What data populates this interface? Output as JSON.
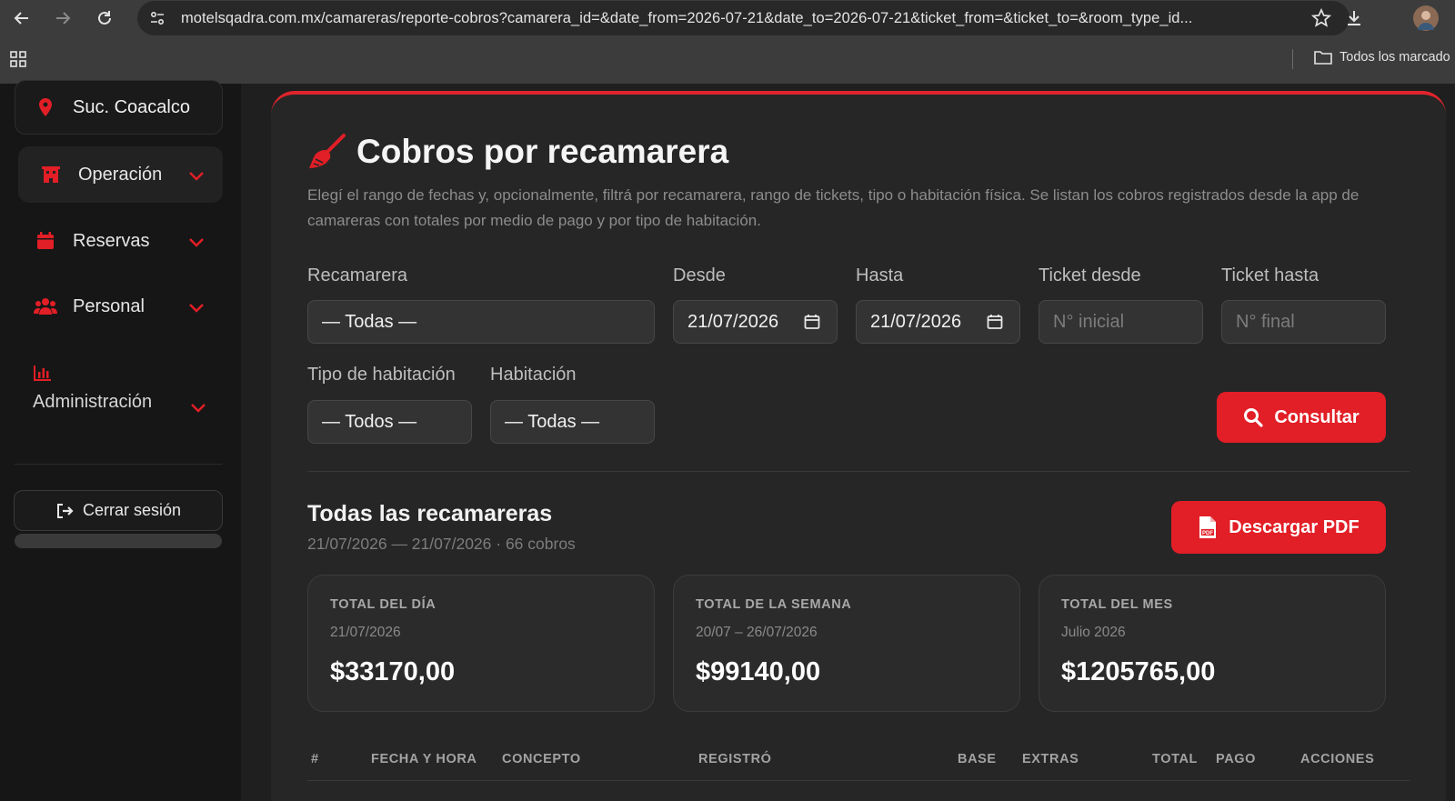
{
  "browser": {
    "url": "motelsqadra.com.mx/camareras/reporte-cobros?camarera_id=&date_from=2026-07-21&date_to=2026-07-21&ticket_from=&ticket_to=&room_type_id...",
    "bookmarks_folder": "Todos los marcado"
  },
  "sidebar": {
    "branch": "Suc. Coacalco",
    "items": [
      {
        "label": "Operación",
        "icon": "building-icon",
        "active": true
      },
      {
        "label": "Reservas",
        "icon": "calendar-icon"
      },
      {
        "label": "Personal",
        "icon": "users-icon"
      },
      {
        "label": "Administración",
        "icon": "chart-icon"
      }
    ],
    "logout": "Cerrar sesión"
  },
  "page": {
    "title": "Cobros por recamarera",
    "description": "Elegí el rango de fechas y, opcionalmente, filtrá por recamarera, rango de tickets, tipo o habitación física. Se listan los cobros registrados desde la app de camareras con totales por medio de pago y por tipo de habitación."
  },
  "filters": {
    "recamarera": {
      "label": "Recamarera",
      "value": "— Todas —"
    },
    "desde": {
      "label": "Desde",
      "value": "21/07/2026"
    },
    "hasta": {
      "label": "Hasta",
      "value": "21/07/2026"
    },
    "ticket_desde": {
      "label": "Ticket desde",
      "placeholder": "N° inicial"
    },
    "ticket_hasta": {
      "label": "Ticket hasta",
      "placeholder": "N° final"
    },
    "tipo_habitacion": {
      "label": "Tipo de habitación",
      "value": "— Todos —"
    },
    "habitacion": {
      "label": "Habitación",
      "value": "— Todas —"
    },
    "consultar": "Consultar"
  },
  "results": {
    "title": "Todas las recamareras",
    "subtitle": "21/07/2026 — 21/07/2026 · 66 cobros",
    "download": "Descargar PDF"
  },
  "cards": [
    {
      "title": "TOTAL DEL DÍA",
      "sub": "21/07/2026",
      "value": "$33170,00"
    },
    {
      "title": "TOTAL DE LA SEMANA",
      "sub": "20/07 – 26/07/2026",
      "value": "$99140,00"
    },
    {
      "title": "TOTAL DEL MES",
      "sub": "Julio 2026",
      "value": "$1205765,00"
    }
  ],
  "table": {
    "headers": [
      "#",
      "FECHA Y HORA",
      "CONCEPTO",
      "REGISTRÓ",
      "BASE",
      "EXTRAS",
      "TOTAL",
      "PAGO",
      "ACCIONES"
    ]
  },
  "colors": {
    "accent": "#e21e26"
  }
}
